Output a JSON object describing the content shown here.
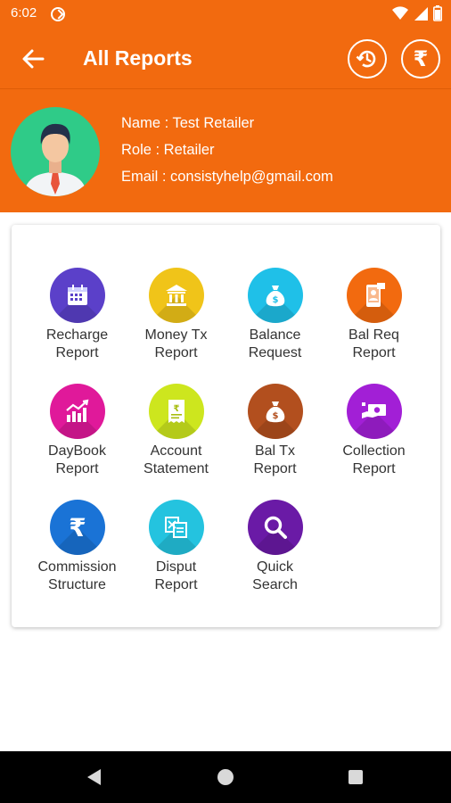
{
  "status_bar": {
    "time": "6:02"
  },
  "app_bar": {
    "title": "All Reports",
    "rupee_symbol": "₹"
  },
  "profile": {
    "name_line": "Name : Test Retailer",
    "role_line": "Role : Retailer",
    "email_line": "Email : consistyhelp@gmail.com"
  },
  "grid": {
    "items": [
      {
        "label": "Recharge\nReport",
        "icon": "calendar-icon",
        "color": "#5b40c9"
      },
      {
        "label": "Money Tx\nReport",
        "icon": "bank-icon",
        "color": "#f0c419"
      },
      {
        "label": "Balance\nRequest",
        "icon": "money-bag-icon",
        "color": "#1fc0e8"
      },
      {
        "label": "Bal Req\nReport",
        "icon": "mobile-person-icon",
        "color": "#f26a0f"
      },
      {
        "label": "DayBook\nReport",
        "icon": "growth-chart-icon",
        "color": "#e0199a"
      },
      {
        "label": "Account\nStatement",
        "icon": "receipt-icon",
        "color": "#cde61e"
      },
      {
        "label": "Bal Tx\nReport",
        "icon": "money-bag-icon",
        "color": "#b24f1e"
      },
      {
        "label": "Collection\nReport",
        "icon": "cash-hand-icon",
        "color": "#a21fd6"
      },
      {
        "label": "Commission\nStructure",
        "icon": "rupee-icon",
        "color": "#1a73d6"
      },
      {
        "label": "Disput\nReport",
        "icon": "document-transfer-icon",
        "color": "#24c3df"
      },
      {
        "label": "Quick\nSearch",
        "icon": "search-icon",
        "color": "#6a1aa6"
      }
    ]
  }
}
